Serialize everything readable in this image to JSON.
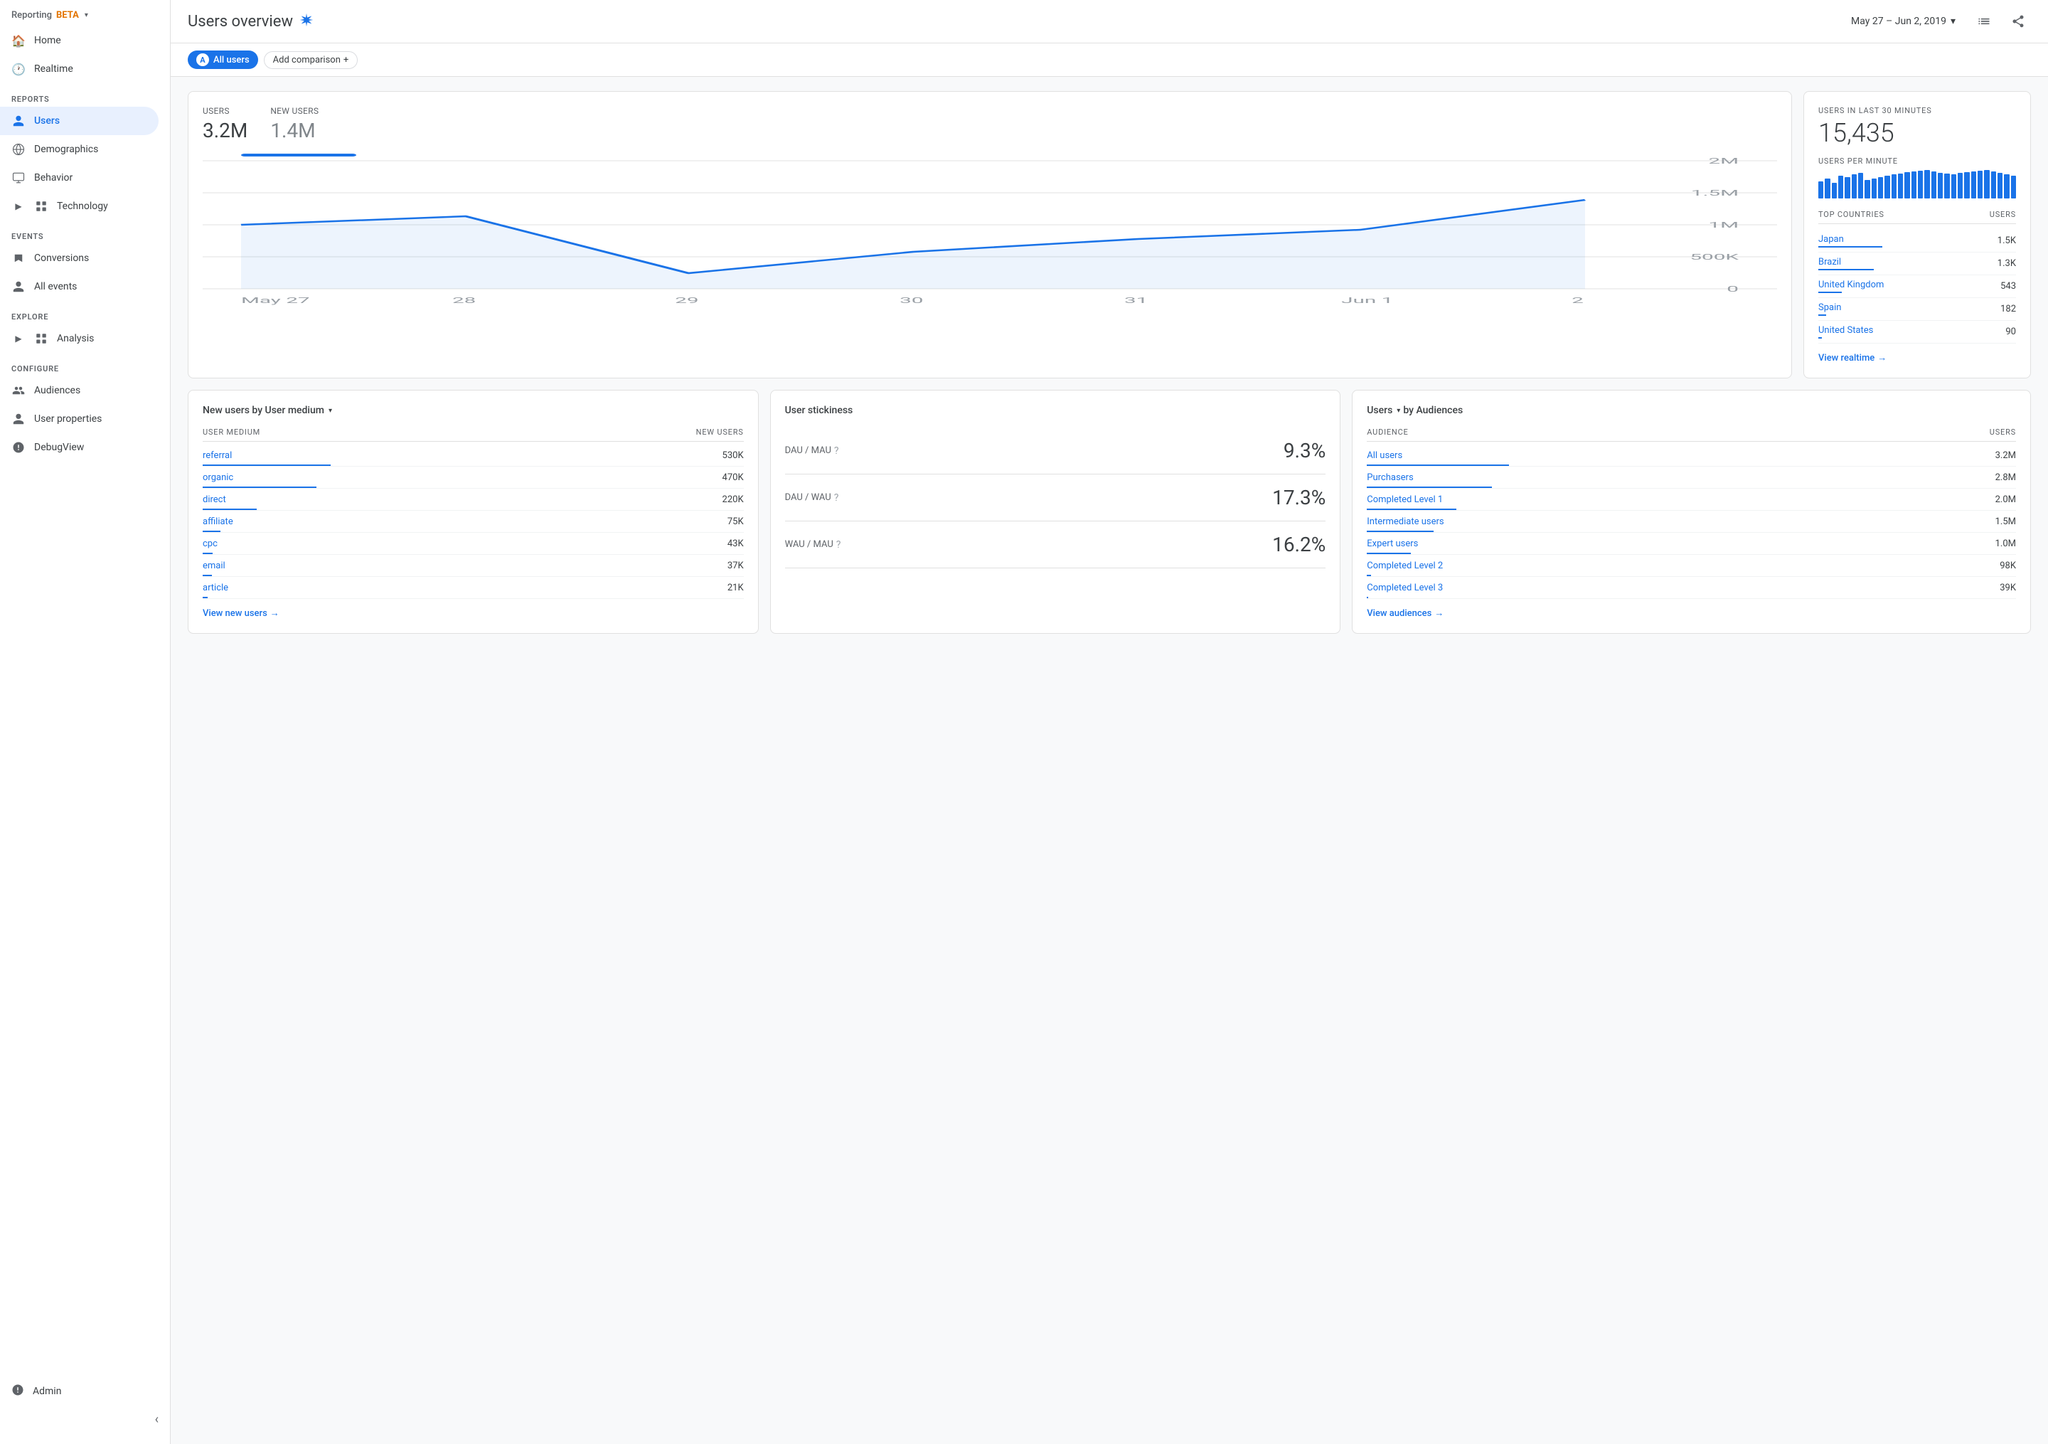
{
  "sidebar": {
    "reporting_label": "Reporting",
    "beta_label": "BETA",
    "nav_items": [
      {
        "id": "home",
        "label": "Home",
        "icon": "🏠"
      },
      {
        "id": "realtime",
        "label": "Realtime",
        "icon": "🕐"
      }
    ],
    "reports_section": "REPORTS",
    "reports_items": [
      {
        "id": "users",
        "label": "Users",
        "icon": "👤",
        "active": true
      },
      {
        "id": "demographics",
        "label": "Demographics",
        "icon": "🌐"
      },
      {
        "id": "behavior",
        "label": "Behavior",
        "icon": "🖥"
      },
      {
        "id": "technology",
        "label": "Technology",
        "icon": "📊",
        "has_expand": true
      }
    ],
    "events_section": "EVENTS",
    "events_items": [
      {
        "id": "conversions",
        "label": "Conversions",
        "icon": "🚩"
      },
      {
        "id": "all_events",
        "label": "All events",
        "icon": "👤"
      }
    ],
    "explore_section": "EXPLORE",
    "explore_items": [
      {
        "id": "analysis",
        "label": "Analysis",
        "icon": "📋",
        "has_expand": true
      }
    ],
    "configure_section": "CONFIGURE",
    "configure_items": [
      {
        "id": "audiences",
        "label": "Audiences",
        "icon": "👥"
      },
      {
        "id": "user_properties",
        "label": "User properties",
        "icon": "👤"
      },
      {
        "id": "debugview",
        "label": "DebugView",
        "icon": "⚙"
      }
    ],
    "admin_label": "Admin",
    "collapse_label": "‹"
  },
  "header": {
    "title": "Users overview",
    "date_range": "May 27 – Jun 2, 2019",
    "all_users_label": "All users",
    "add_comparison_label": "Add comparison",
    "avatar_letter": "A"
  },
  "main_chart": {
    "users_label": "Users",
    "users_value": "3.2M",
    "new_users_label": "New users",
    "new_users_value": "1.4M",
    "x_labels": [
      "May 27",
      "28",
      "29",
      "30",
      "31",
      "Jun 1",
      "2"
    ],
    "y_labels": [
      "2M",
      "1.5M",
      "1M",
      "500K",
      "0"
    ]
  },
  "realtime": {
    "section_label": "USERS IN LAST 30 MINUTES",
    "count": "15,435",
    "per_minute_label": "USERS PER MINUTE",
    "bar_heights": [
      60,
      70,
      55,
      80,
      75,
      85,
      90,
      65,
      70,
      75,
      80,
      85,
      88,
      92,
      95,
      98,
      100,
      95,
      90,
      88,
      85,
      90,
      92,
      95,
      98,
      100,
      95,
      90,
      85,
      80
    ],
    "top_countries_label": "TOP COUNTRIES",
    "users_label": "USERS",
    "countries": [
      {
        "name": "Japan",
        "users": "1.5K",
        "bar_pct": 90
      },
      {
        "name": "Brazil",
        "users": "1.3K",
        "bar_pct": 78
      },
      {
        "name": "United Kingdom",
        "users": "543",
        "bar_pct": 33
      },
      {
        "name": "Spain",
        "users": "182",
        "bar_pct": 11
      },
      {
        "name": "United States",
        "users": "90",
        "bar_pct": 5
      }
    ],
    "view_realtime_label": "View realtime",
    "view_realtime_arrow": "→"
  },
  "new_users_card": {
    "title": "New users by User medium",
    "col1": "USER MEDIUM",
    "col2": "NEW USERS",
    "rows": [
      {
        "label": "referral",
        "value": "530K",
        "bar_pct": 100
      },
      {
        "label": "organic",
        "value": "470K",
        "bar_pct": 89
      },
      {
        "label": "direct",
        "value": "220K",
        "bar_pct": 42
      },
      {
        "label": "affiliate",
        "value": "75K",
        "bar_pct": 14
      },
      {
        "label": "cpc",
        "value": "43K",
        "bar_pct": 8
      },
      {
        "label": "email",
        "value": "37K",
        "bar_pct": 7
      },
      {
        "label": "article",
        "value": "21K",
        "bar_pct": 4
      }
    ],
    "view_label": "View new users",
    "view_arrow": "→"
  },
  "stickiness_card": {
    "title": "User stickiness",
    "metrics": [
      {
        "label": "DAU / MAU",
        "value": "9.3%"
      },
      {
        "label": "DAU / WAU",
        "value": "17.3%"
      },
      {
        "label": "WAU / MAU",
        "value": "16.2%"
      }
    ]
  },
  "audiences_card": {
    "title": "Users",
    "by_label": "by Audiences",
    "col1": "AUDIENCE",
    "col2": "USERS",
    "rows": [
      {
        "label": "All users",
        "value": "3.2M",
        "bar_pct": 100
      },
      {
        "label": "Purchasers",
        "value": "2.8M",
        "bar_pct": 88
      },
      {
        "label": "Completed Level 1",
        "value": "2.0M",
        "bar_pct": 63
      },
      {
        "label": "Intermediate users",
        "value": "1.5M",
        "bar_pct": 47
      },
      {
        "label": "Expert users",
        "value": "1.0M",
        "bar_pct": 31
      },
      {
        "label": "Completed Level 2",
        "value": "98K",
        "bar_pct": 3
      },
      {
        "label": "Completed Level 3",
        "value": "39K",
        "bar_pct": 1
      }
    ],
    "view_label": "View audiences",
    "view_arrow": "→"
  }
}
